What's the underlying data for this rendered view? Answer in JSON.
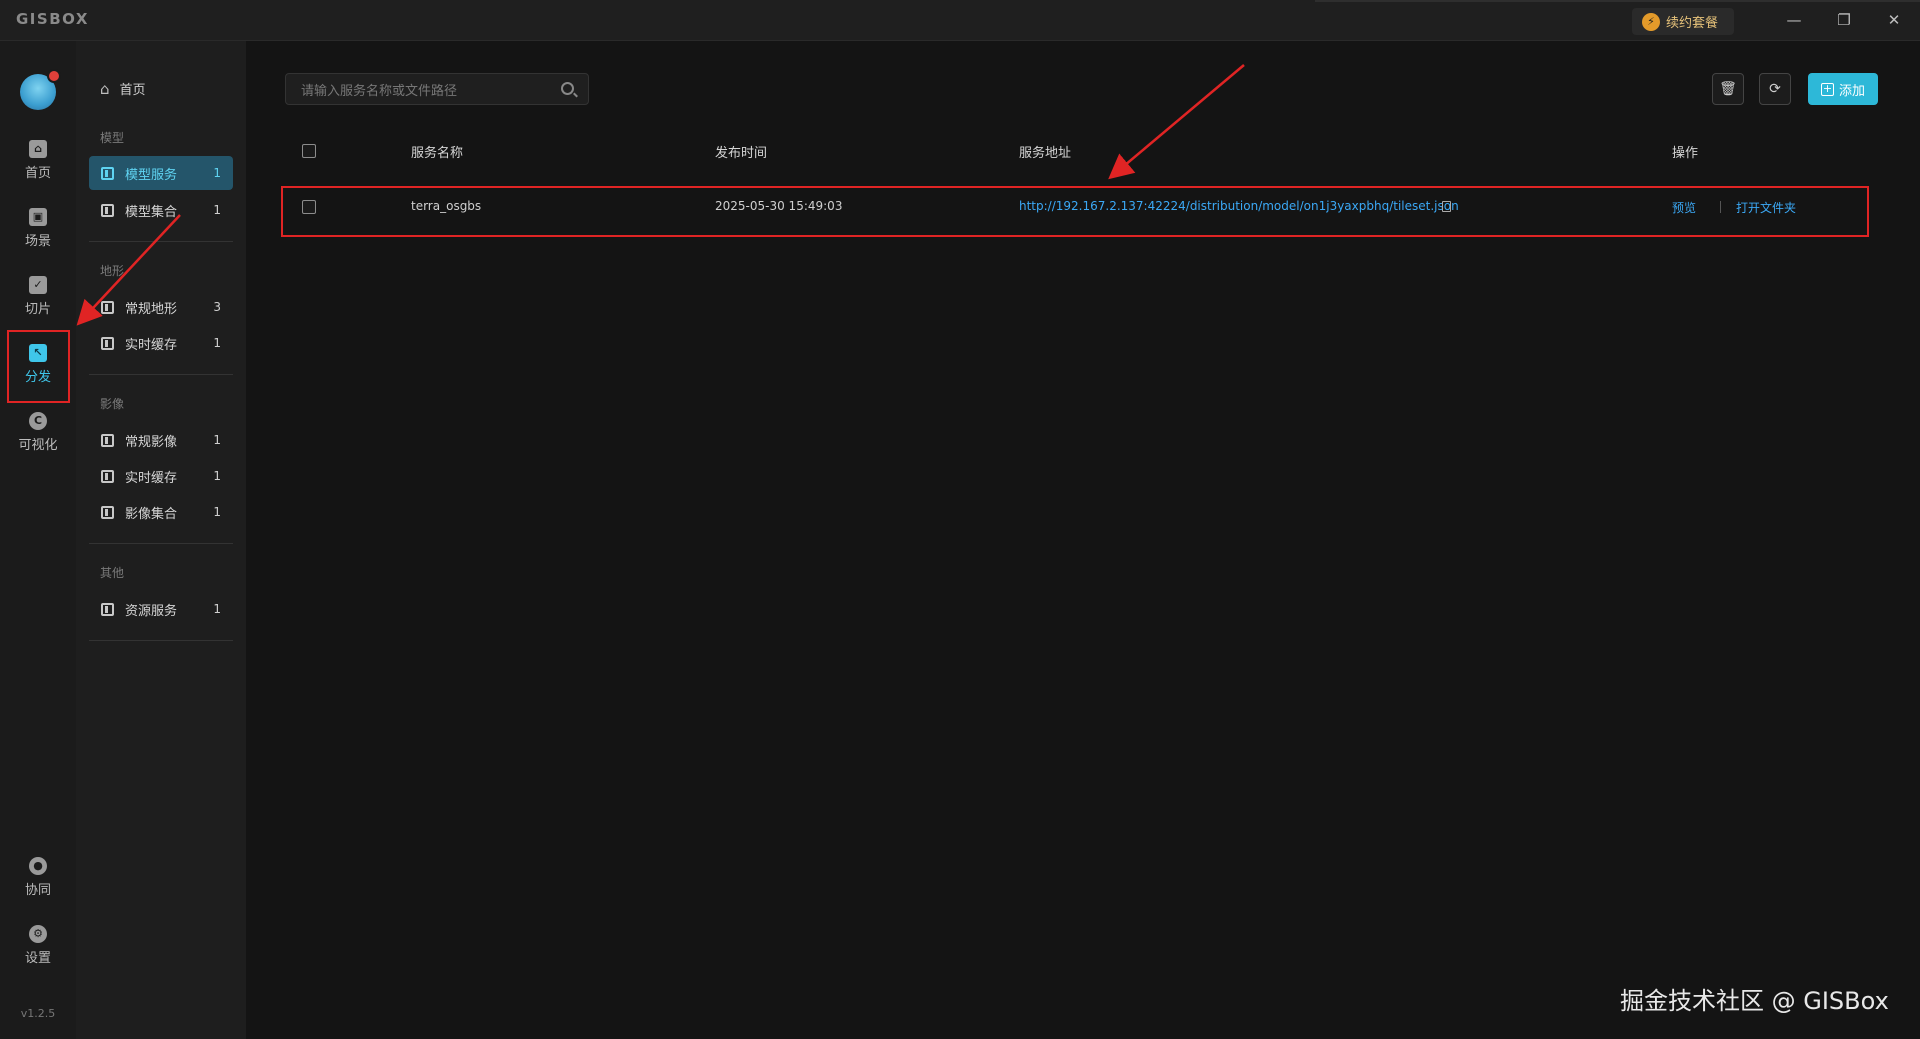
{
  "app": {
    "logo": "GISBOX",
    "renew_label": "续约套餐",
    "version": "v1.2.5"
  },
  "sidebar": {
    "items": [
      {
        "label": "首页",
        "icon": "home-icon"
      },
      {
        "label": "场景",
        "icon": "scene-icon"
      },
      {
        "label": "切片",
        "icon": "slice-icon"
      },
      {
        "label": "分发",
        "icon": "distribute-icon",
        "active": true
      },
      {
        "label": "可视化",
        "icon": "visualize-icon"
      },
      {
        "label": "协同",
        "icon": "collaborate-icon"
      },
      {
        "label": "设置",
        "icon": "settings-icon"
      }
    ]
  },
  "subnav": {
    "home": "首页",
    "groups": [
      {
        "title": "模型",
        "items": [
          {
            "label": "模型服务",
            "count": "1",
            "active": true
          },
          {
            "label": "模型集合",
            "count": "1"
          }
        ]
      },
      {
        "title": "地形",
        "items": [
          {
            "label": "常规地形",
            "count": "3"
          },
          {
            "label": "实时缓存",
            "count": "1"
          }
        ]
      },
      {
        "title": "影像",
        "items": [
          {
            "label": "常规影像",
            "count": "1"
          },
          {
            "label": "实时缓存",
            "count": "1"
          },
          {
            "label": "影像集合",
            "count": "1"
          }
        ]
      },
      {
        "title": "其他",
        "items": [
          {
            "label": "资源服务",
            "count": "1"
          }
        ]
      }
    ]
  },
  "toolbar": {
    "search_placeholder": "请输入服务名称或文件路径",
    "add_label": "添加"
  },
  "table": {
    "headers": [
      "服务名称",
      "发布时间",
      "服务地址",
      "操作"
    ],
    "rows": [
      {
        "name": "terra_osgbs",
        "time": "2025-05-30 15:49:03",
        "url": "http://192.167.2.137:42224/distribution/model/on1j3yaxpbhq/tileset.json",
        "action_preview": "预览",
        "action_open": "打开文件夹"
      }
    ]
  },
  "watermark": "掘金技术社区 @ GISBox",
  "colors": {
    "accent": "#2db8d8",
    "link": "#3ba8f5",
    "annotation": "#e02424"
  }
}
